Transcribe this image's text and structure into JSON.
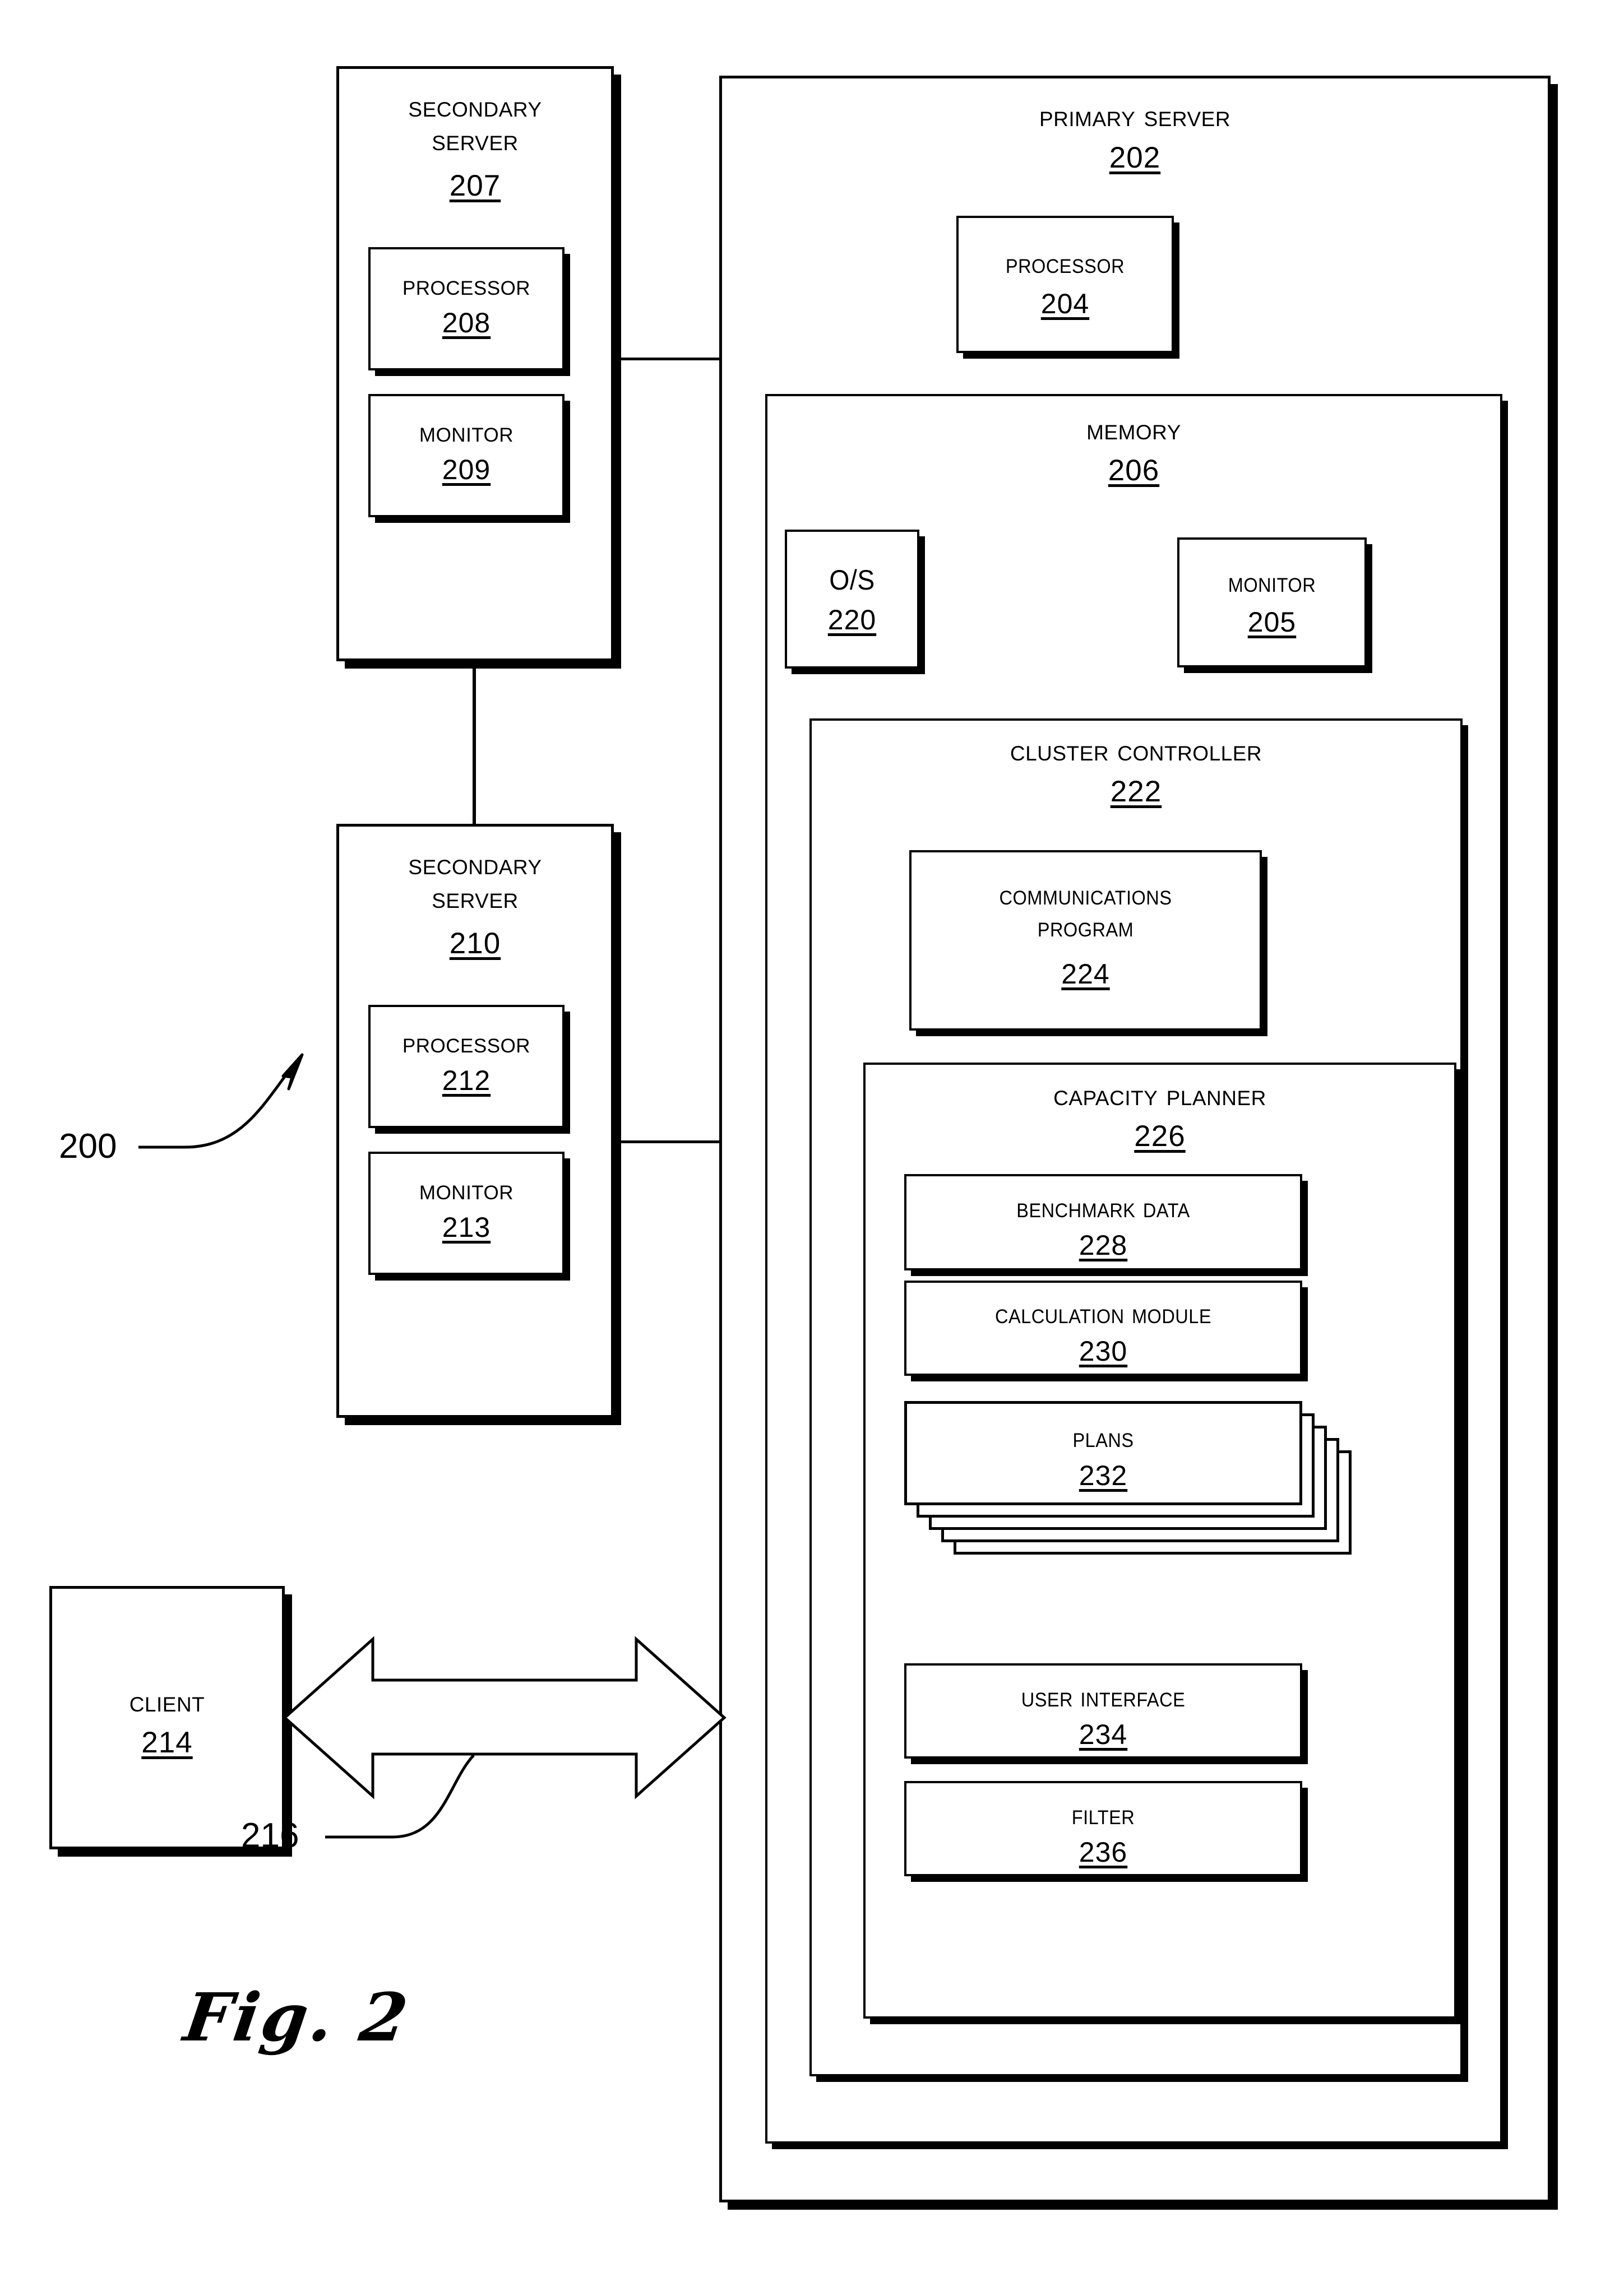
{
  "figure": {
    "caption": "Fig. 2",
    "system_ref": "200",
    "link_ref": "216"
  },
  "secondary_server_1": {
    "title_line1": "Secondary",
    "title_line2": "Server",
    "ref": "207",
    "children": [
      {
        "title": "Processor",
        "ref": "208"
      },
      {
        "title": "Monitor",
        "ref": "209"
      }
    ]
  },
  "secondary_server_2": {
    "title_line1": "Secondary",
    "title_line2": "Server",
    "ref": "210",
    "children": [
      {
        "title": "Processor",
        "ref": "212"
      },
      {
        "title": "Monitor",
        "ref": "213"
      }
    ]
  },
  "client": {
    "title": "Client",
    "ref": "214"
  },
  "primary_server": {
    "title": "Primary Server",
    "ref": "202",
    "processor": {
      "title": "Processor",
      "ref": "204"
    },
    "memory": {
      "title": "Memory",
      "ref": "206",
      "os": {
        "title": "O/S",
        "ref": "220"
      },
      "monitor": {
        "title": "Monitor",
        "ref": "205"
      },
      "cluster_controller": {
        "title": "Cluster Controller",
        "ref": "222",
        "communications_program": {
          "title_line1": "Communications",
          "title_line2": "Program",
          "ref": "224"
        },
        "capacity_planner": {
          "title": "Capacity Planner",
          "ref": "226",
          "benchmark_data": {
            "title": "Benchmark Data",
            "ref": "228"
          },
          "calculation_module": {
            "title": "Calculation Module",
            "ref": "230"
          },
          "plans": {
            "title": "Plans",
            "ref": "232",
            "stack_count": 5
          },
          "user_interface": {
            "title": "User Interface",
            "ref": "234"
          },
          "filter": {
            "title": "Filter",
            "ref": "236"
          }
        }
      }
    }
  },
  "colors": {
    "stroke": "#000000",
    "background": "#ffffff"
  }
}
